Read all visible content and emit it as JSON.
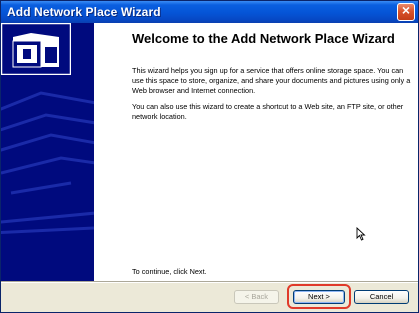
{
  "window": {
    "title": "Add Network Place Wizard",
    "close_symbol": "×"
  },
  "content": {
    "heading": "Welcome to the Add Network Place Wizard",
    "paragraph1": "This wizard helps you sign up for a service that offers online storage space.  You can use this space to store, organize, and share your documents and pictures using only a Web browser and Internet connection.",
    "paragraph2": "You can also use this wizard to create a shortcut to a Web site, an FTP site, or other network location.",
    "continue_text": "To continue, click Next."
  },
  "buttons": {
    "back_label": "< Back",
    "next_label": "Next >",
    "cancel_label": "Cancel"
  },
  "icons": {
    "wizard_logo": "network-folder-icon",
    "close": "close-icon",
    "cursor": "mouse-cursor-icon"
  },
  "colors": {
    "title_bar": "#0554d6",
    "banner": "#000a7e",
    "highlight_ring": "#e03a2a"
  }
}
